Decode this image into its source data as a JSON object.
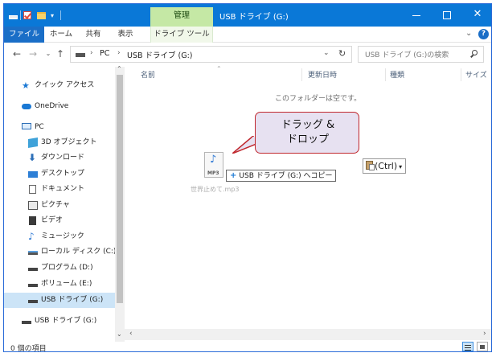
{
  "window": {
    "title": "USB ドライブ (G:)",
    "context_tab": "管理"
  },
  "ribbon": {
    "tabs": [
      "ファイル",
      "ホーム",
      "共有",
      "表示",
      "ドライブ ツール"
    ]
  },
  "address": {
    "crumbs": [
      "PC",
      "USB ドライブ (G:)"
    ],
    "search_placeholder": "USB ドライブ (G:)の検索"
  },
  "nav": {
    "items": [
      {
        "label": "クイック アクセス",
        "icon": "star-icon"
      },
      {
        "label": "OneDrive",
        "icon": "cloud-icon"
      },
      {
        "label": "PC",
        "icon": "pc-icon"
      },
      {
        "label": "3D オブジェクト",
        "icon": "cube-icon"
      },
      {
        "label": "ダウンロード",
        "icon": "download-icon"
      },
      {
        "label": "デスクトップ",
        "icon": "desktop-icon"
      },
      {
        "label": "ドキュメント",
        "icon": "document-icon"
      },
      {
        "label": "ピクチャ",
        "icon": "picture-icon"
      },
      {
        "label": "ビデオ",
        "icon": "video-icon"
      },
      {
        "label": "ミュージック",
        "icon": "music-icon"
      },
      {
        "label": "ローカル ディスク (C:)",
        "icon": "local-disk-icon"
      },
      {
        "label": "プログラム (D:)",
        "icon": "drive-icon"
      },
      {
        "label": "ボリューム (E:)",
        "icon": "drive-icon"
      },
      {
        "label": "USB ドライブ (G:)",
        "icon": "usb-drive-icon",
        "selected": true
      },
      {
        "label": "USB ドライブ (G:)",
        "icon": "usb-drive-icon"
      }
    ]
  },
  "columns": [
    "名前",
    "更新日時",
    "種類",
    "サイズ"
  ],
  "content": {
    "empty_message": "このフォルダーは空です。",
    "callout": "ドラッグ &\nドロップ",
    "drag_tooltip": "USB ドライブ (G:) へコピー",
    "drag_file_badge": "MP3",
    "dragged_file_name": "世界止めて.mp3",
    "paste_chip": "(Ctrl)"
  },
  "status": {
    "item_count": "0 個の項目"
  },
  "colors": {
    "titlebar": "#0a78d7",
    "manage_tab": "#c5e8a5",
    "callout_border": "#c0272d",
    "callout_fill": "#e7e1f1",
    "selection": "#cce4f7"
  }
}
